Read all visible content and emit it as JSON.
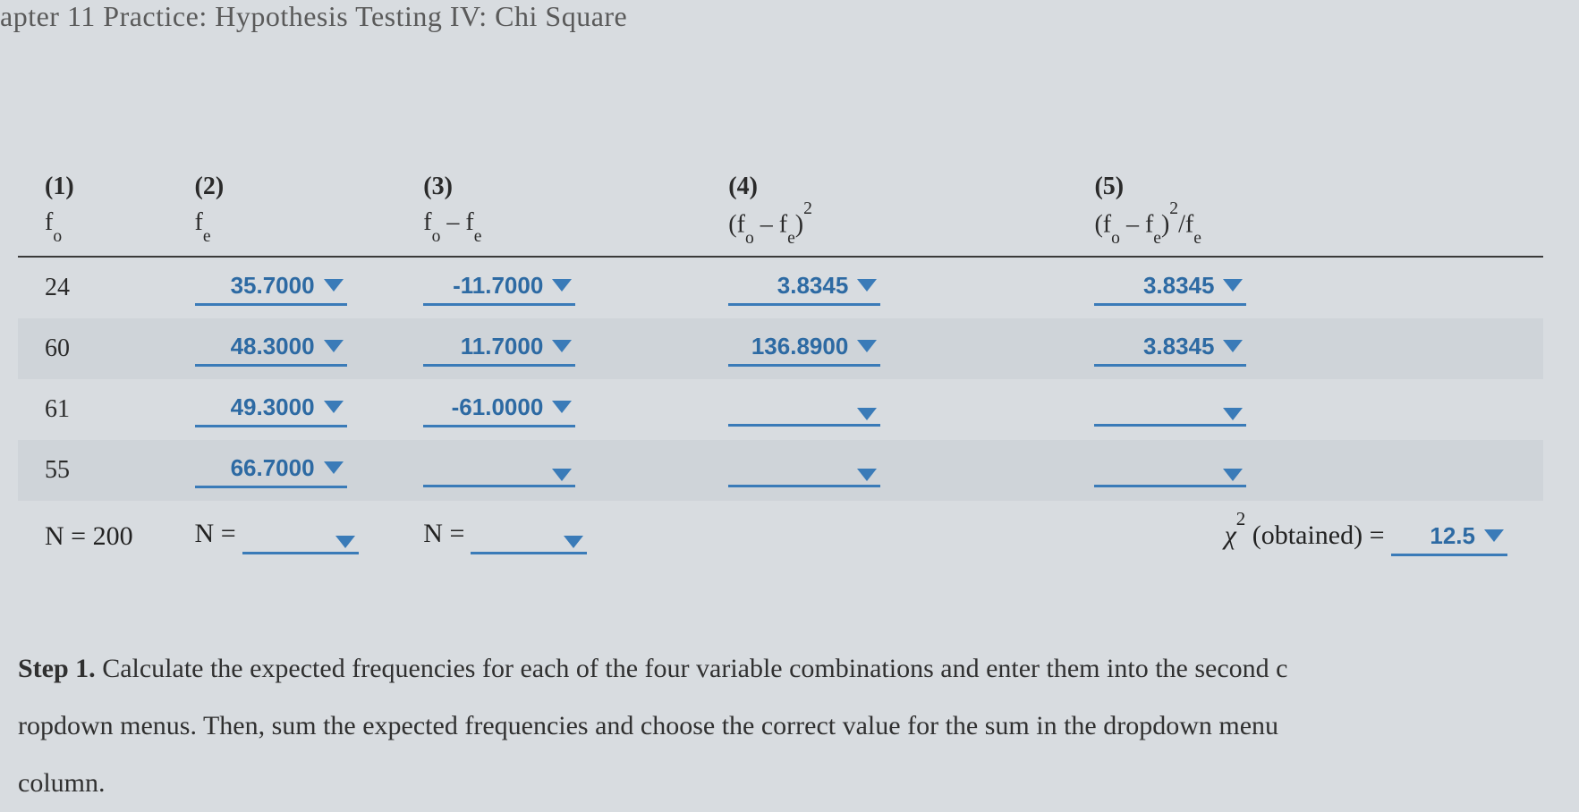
{
  "page_title": "apter 11 Practice: Hypothesis Testing IV: Chi Square",
  "table": {
    "headers": [
      {
        "num": "(1)",
        "label_html": "f_o"
      },
      {
        "num": "(2)",
        "label_html": "f_e"
      },
      {
        "num": "(3)",
        "label_html": "f_o - f_e"
      },
      {
        "num": "(4)",
        "label_html": "(f_o - f_e)^2"
      },
      {
        "num": "(5)",
        "label_html": "(f_o - f_e)^2 / f_e"
      }
    ],
    "rows": [
      {
        "fo": "24",
        "fe": "35.7000",
        "diff": "-11.7000",
        "sq": "3.8345",
        "ratio": "3.8345"
      },
      {
        "fo": "60",
        "fe": "48.3000",
        "diff": "11.7000",
        "sq": "136.8900",
        "ratio": "3.8345"
      },
      {
        "fo": "61",
        "fe": "49.3000",
        "diff": "-61.0000",
        "sq": "",
        "ratio": ""
      },
      {
        "fo": "55",
        "fe": "66.7000",
        "diff": "",
        "sq": "",
        "ratio": ""
      }
    ],
    "totals": {
      "n_fo": "N = 200",
      "n_fe_label": "N =",
      "n_fe_value": "",
      "n_diff_label": "N =",
      "n_diff_value": "",
      "chi_label": "χ² (obtained) =",
      "chi_value": "12.5"
    }
  },
  "instructions": {
    "step_label": "Step 1.",
    "line1": " Calculate the expected frequencies for each of the four variable combinations and enter them into the second c",
    "line2": "ropdown menus. Then, sum the expected frequencies and choose the correct value for the sum in the dropdown menu",
    "line3": " column."
  }
}
